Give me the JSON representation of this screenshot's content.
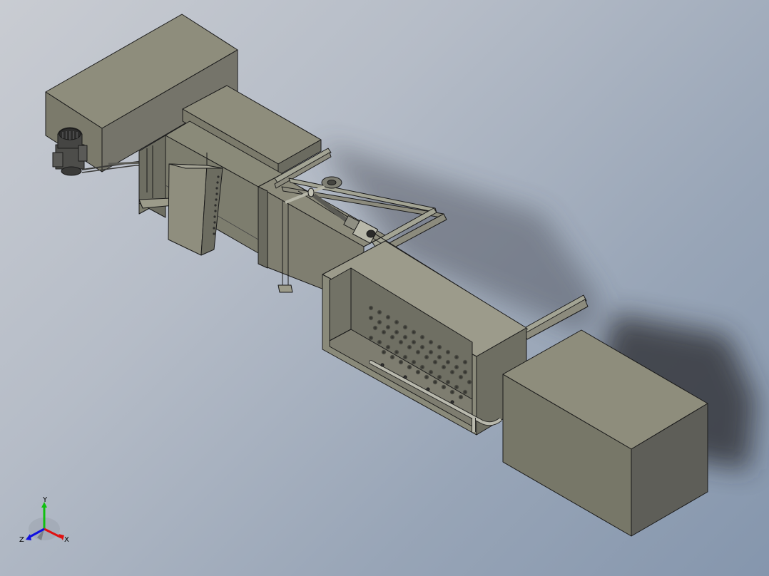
{
  "viewport": {
    "background_top": "#c9ccd2",
    "background_bottom": "#8596ad",
    "part_face_light": "#8e8d7c",
    "part_face_mid": "#7b7a6b",
    "part_face_dark": "#5e5e58",
    "edge_color": "#1a1a1a"
  },
  "triad": {
    "x_label": "X",
    "y_label": "Y",
    "z_label": "Z",
    "x_color": "#e01010",
    "y_color": "#10c010",
    "z_color": "#1010e0"
  }
}
